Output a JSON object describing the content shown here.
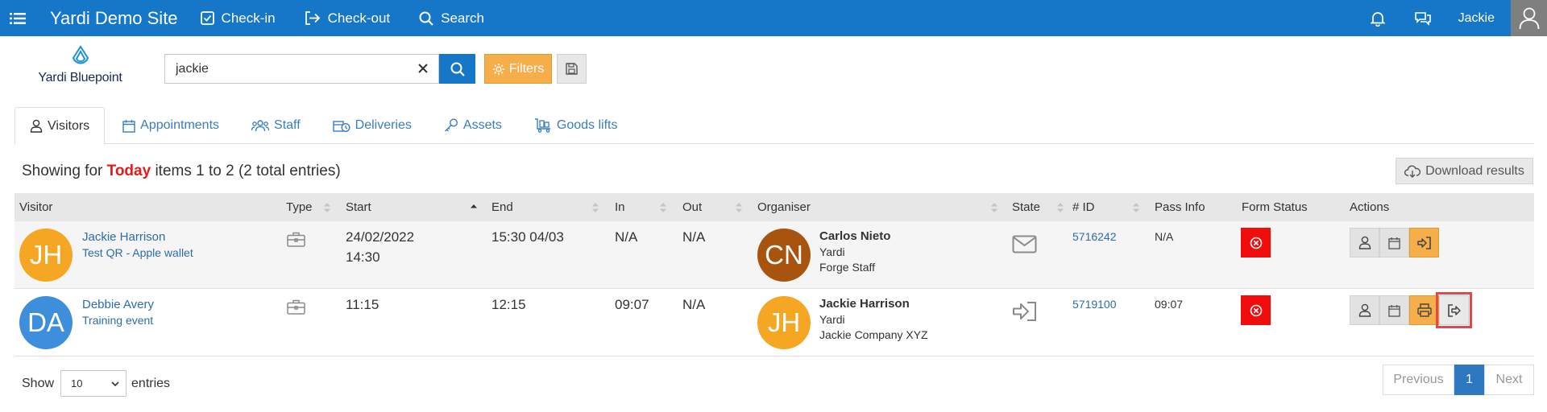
{
  "topbar": {
    "title": "Yardi Demo Site",
    "nav": [
      {
        "label": "Check-in",
        "icon": "checkbox-icon"
      },
      {
        "label": "Check-out",
        "icon": "sign-out-icon"
      },
      {
        "label": "Search",
        "icon": "search-icon"
      }
    ],
    "user_name": "Jackie"
  },
  "logo": {
    "text": "Yardi Bluepoint"
  },
  "search": {
    "value": "jackie",
    "filters_label": "Filters"
  },
  "tabs": [
    {
      "label": "Visitors",
      "active": true
    },
    {
      "label": "Appointments"
    },
    {
      "label": "Staff"
    },
    {
      "label": "Deliveries"
    },
    {
      "label": "Assets"
    },
    {
      "label": "Goods lifts"
    }
  ],
  "summary": {
    "prefix": "Showing for",
    "period": "Today",
    "suffix": "items 1 to 2 (2 total entries)",
    "download_label": "Download results"
  },
  "table": {
    "columns": [
      "Visitor",
      "Type",
      "Start",
      "End",
      "In",
      "Out",
      "Organiser",
      "State",
      "# ID",
      "Pass Info",
      "Form Status",
      "Actions"
    ],
    "rows": [
      {
        "initials": "JH",
        "avatar_color": "#f5a623",
        "name": "Jackie Harrison",
        "subtitle": "Test QR - Apple wallet",
        "start_line1": "24/02/2022",
        "start_line2": "14:30",
        "end": "15:30 04/03",
        "in": "N/A",
        "out": "N/A",
        "org_initials": "CN",
        "org_color": "#a8530e",
        "org_name": "Carlos Nieto",
        "org_company": "Yardi",
        "org_detail": "Forge Staff",
        "state_icon": "envelope-icon",
        "id": "5716242",
        "pass_info": "N/A"
      },
      {
        "initials": "DA",
        "avatar_color": "#3d8fdc",
        "name": "Debbie Avery",
        "subtitle": "Training event",
        "start_line1": "11:15",
        "start_line2": "",
        "end": "12:15",
        "in": "09:07",
        "out": "N/A",
        "org_initials": "JH",
        "org_color": "#f5a623",
        "org_name": "Jackie Harrison",
        "org_company": "Yardi",
        "org_detail": "Jackie Company XYZ",
        "state_icon": "sign-in-icon",
        "id": "5719100",
        "pass_info": "09:07"
      }
    ]
  },
  "footer": {
    "show_label": "Show",
    "entries_value": "10",
    "entries_label": "entries",
    "prev_label": "Previous",
    "page": "1",
    "next_label": "Next"
  },
  "colors": {
    "primary": "#1676c7",
    "accent_orange": "#f5ae4a",
    "danger_red": "#f20d0d",
    "today_red": "#e31b1b",
    "highlight_outline": "#e0484b"
  }
}
